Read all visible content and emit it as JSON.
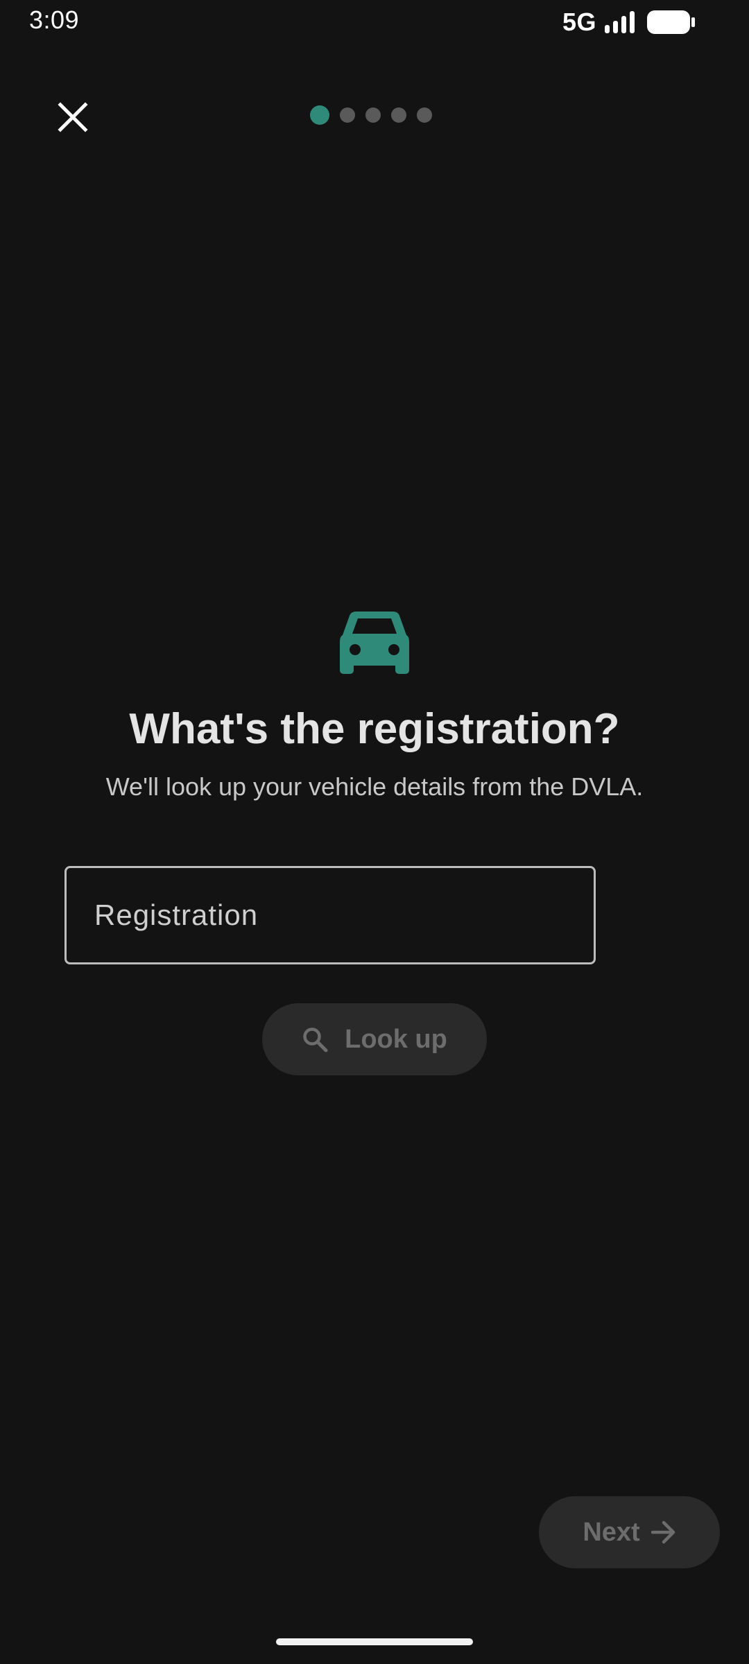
{
  "status_bar": {
    "time": "3:09",
    "network": "5G",
    "icons": [
      "signal-bars-icon",
      "battery-icon"
    ]
  },
  "header": {
    "close_icon": "close-icon",
    "steps": {
      "total": 5,
      "current": 1
    }
  },
  "main": {
    "icon": "car-icon",
    "title": "What's the registration?",
    "subtitle": "We'll look up your vehicle details from the DVLA.",
    "registration": {
      "value": "",
      "placeholder": "Registration"
    },
    "lookup_button": {
      "icon": "search-icon",
      "label": "Look up",
      "enabled": false
    }
  },
  "footer": {
    "next_button": {
      "label": "Next",
      "icon": "arrow-right-icon",
      "enabled": false
    }
  },
  "colors": {
    "background": "#131313",
    "accent": "#2f8a79",
    "disabled_button": "#2a2a2a",
    "disabled_text": "#6d6d6d"
  }
}
